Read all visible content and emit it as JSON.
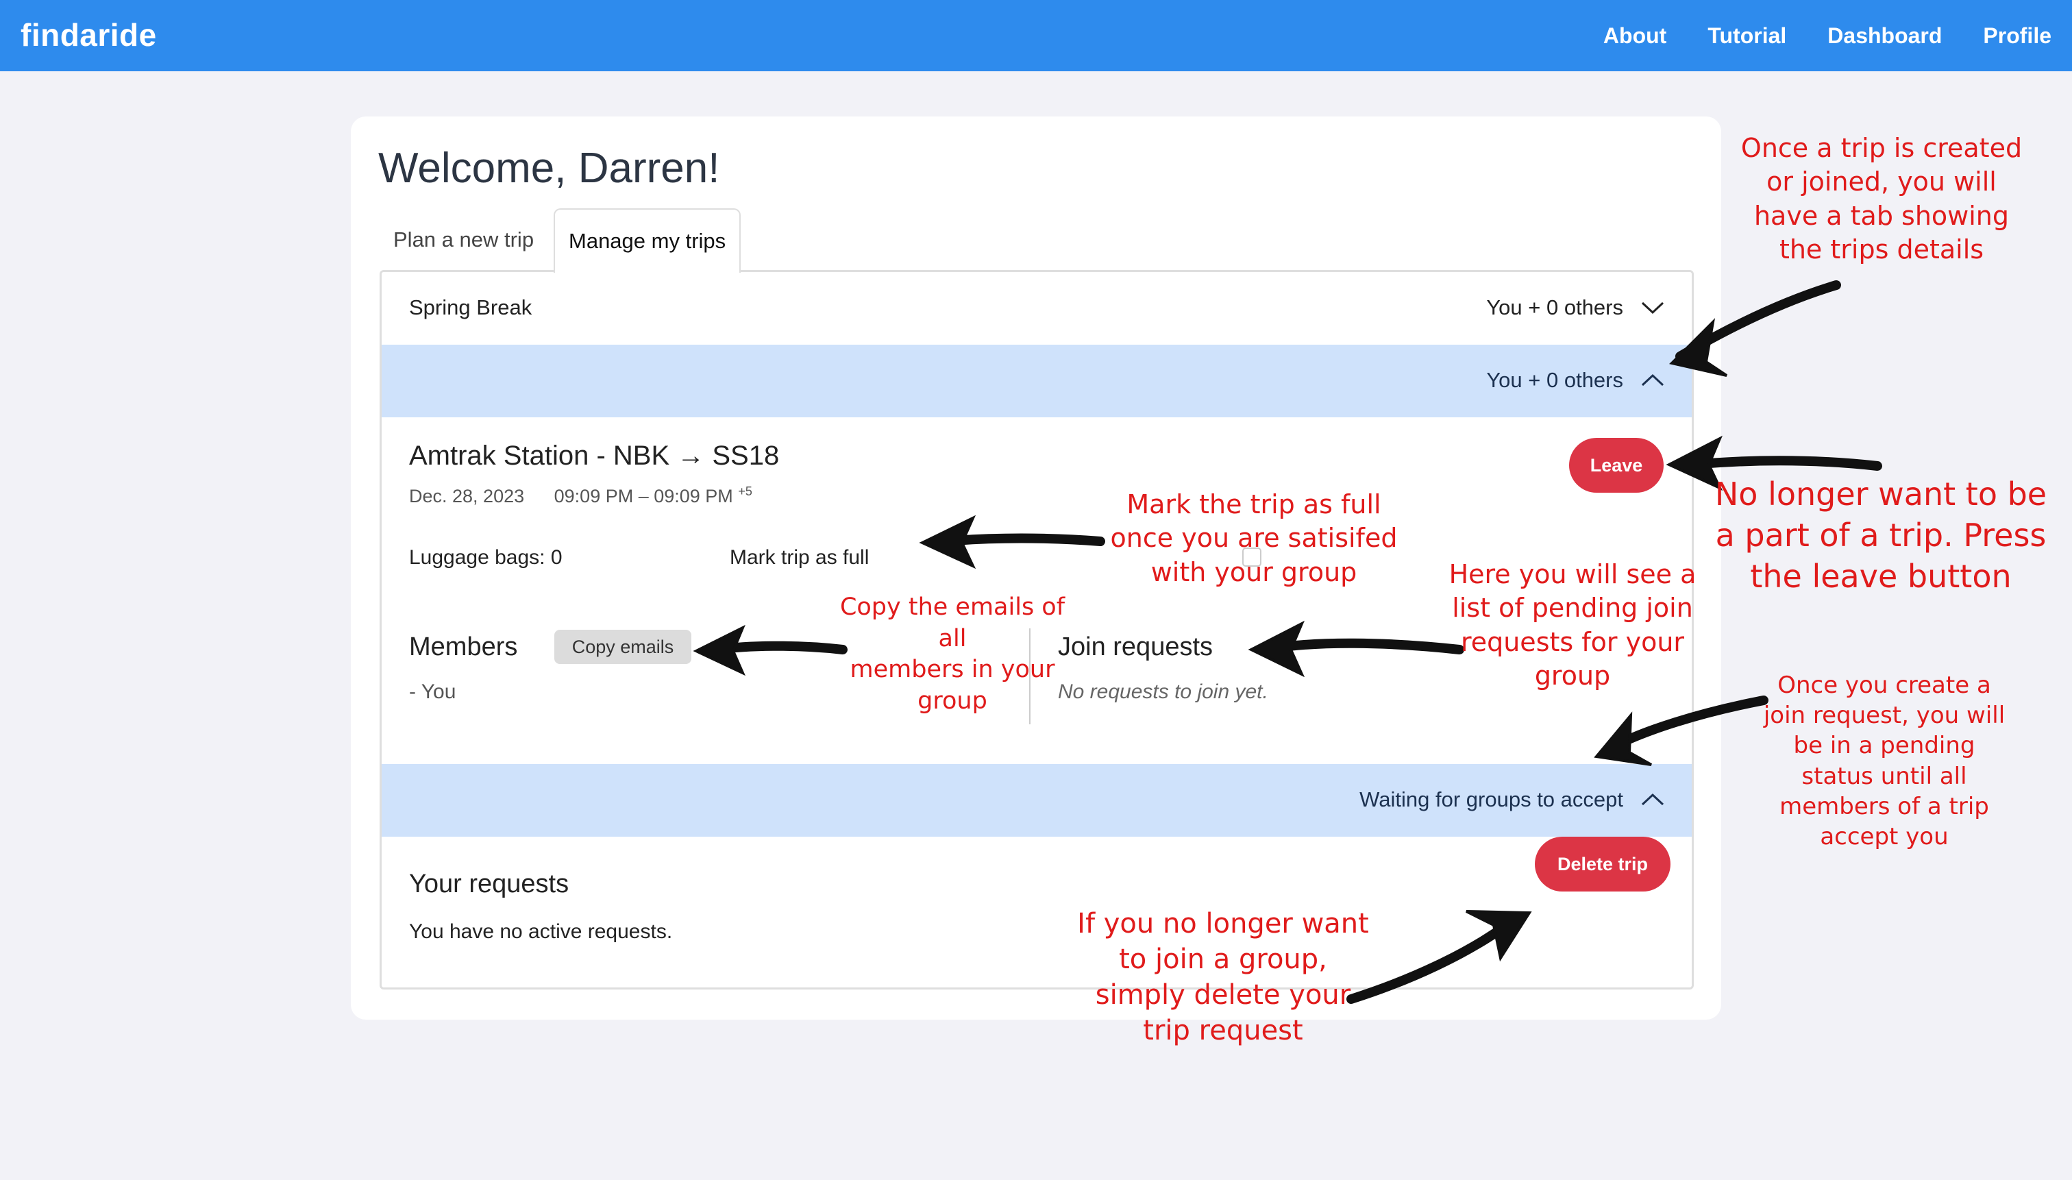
{
  "navbar": {
    "brand": "findaride",
    "links": [
      "About",
      "Tutorial",
      "Dashboard",
      "Profile"
    ]
  },
  "main": {
    "welcome": "Welcome, Darren!",
    "tabs": [
      {
        "label": "Plan a new trip",
        "active": false
      },
      {
        "label": "Manage my trips",
        "active": true
      }
    ]
  },
  "trip": {
    "name": "Spring Break",
    "summary_collapsed": "You + 0 others",
    "summary_expanded": "You + 0 others",
    "route": "Amtrak Station - NBK → SS18",
    "date": "Dec. 28, 2023",
    "time": "09:09 PM – 09:09 PM",
    "time_offset": "+5",
    "leave_label": "Leave",
    "luggage": "Luggage bags: 0",
    "mark_full_label": "Mark trip as full",
    "mark_full_checked": false,
    "members_title": "Members",
    "copy_emails_label": "Copy emails",
    "members": [
      "- You"
    ],
    "join_requests_title": "Join requests",
    "join_requests_empty": "No requests to join yet."
  },
  "requests": {
    "header": "Waiting for groups to accept",
    "title": "Your requests",
    "empty": "You have no active requests.",
    "delete_label": "Delete trip"
  },
  "annotations": {
    "tab_note": "Once a trip is created\nor joined, you will\nhave a tab showing\nthe trips details",
    "leave_note": "No longer want to be\na part of a trip. Press\nthe leave button",
    "full_note": "Mark the trip as full\nonce you are satisifed\nwith your group",
    "copy_note": "Copy the emails of all\nmembers in your\ngroup",
    "join_note": "Here you will see a\nlist of pending join\nrequests for your\ngroup",
    "pending_note": "Once you create a\njoin request, you will\nbe in a pending\nstatus until all\nmembers of a trip\naccept you",
    "delete_note": "If you no longer want\nto join a group,\nsimply delete your\ntrip request"
  },
  "colors": {
    "navbar": "#2e8bed",
    "accent_blue_row": "#cfe2fb",
    "danger": "#dc3545",
    "annotation": "#e01b1b"
  }
}
